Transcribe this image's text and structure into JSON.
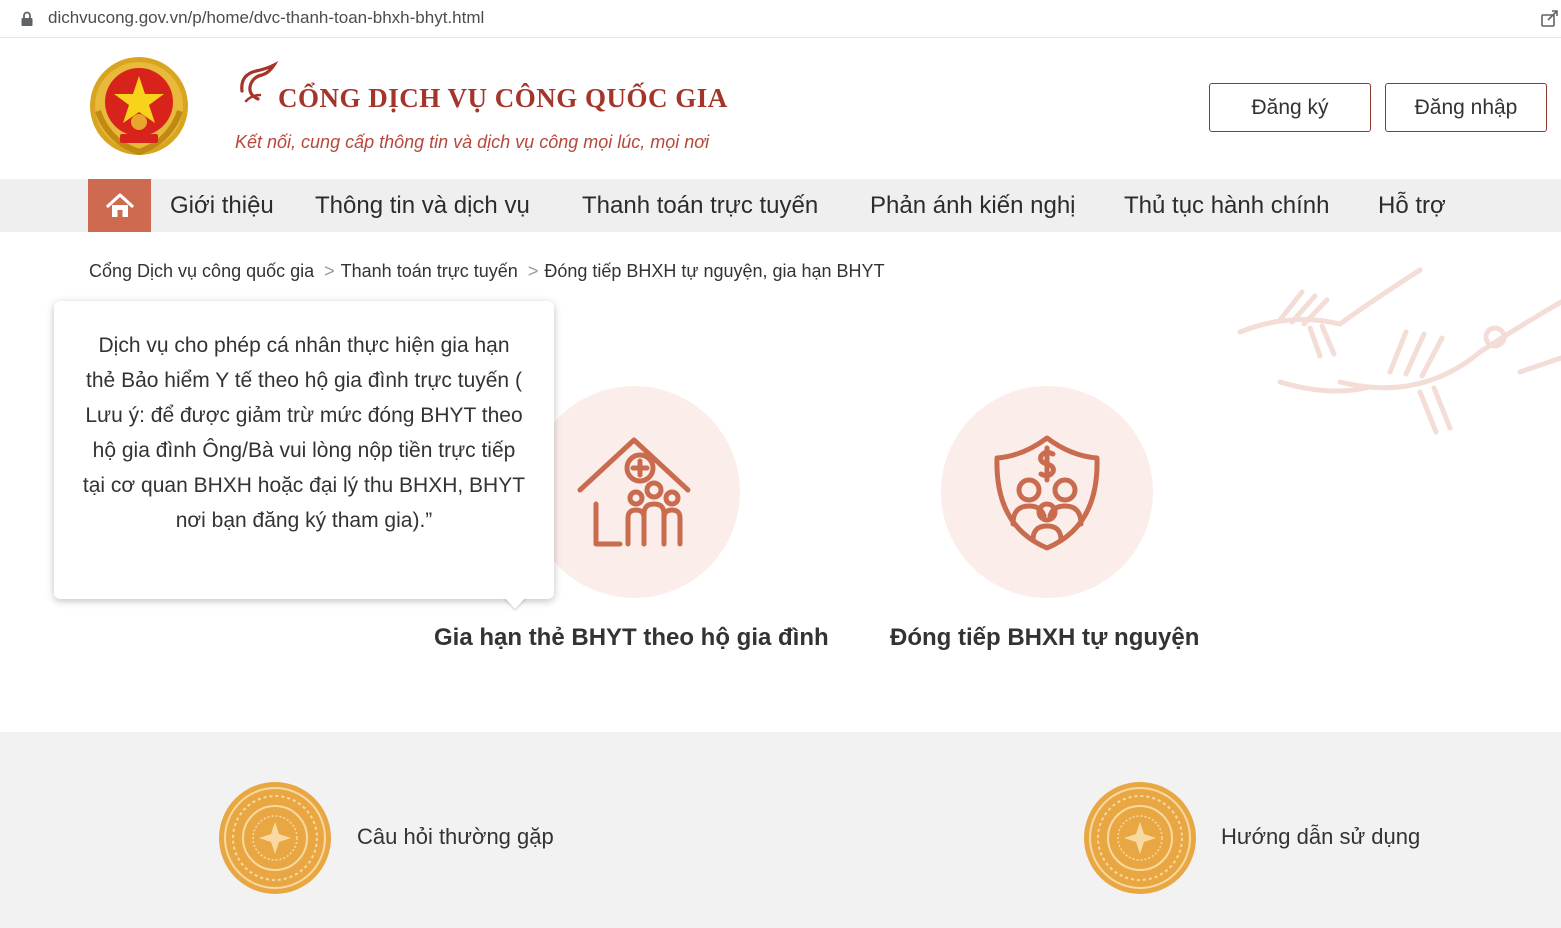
{
  "browser": {
    "url": "dichvucong.gov.vn/p/home/dvc-thanh-toan-bhxh-bhyt.html",
    "lock_icon": "lock-icon",
    "share_icon": "share-icon"
  },
  "header": {
    "title": "CỔNG DỊCH VỤ CÔNG QUỐC GIA",
    "tagline": "Kết nối, cung cấp thông tin và dịch vụ công mọi lúc, mọi nơi",
    "register_label": "Đăng ký",
    "login_label": "Đăng nhập"
  },
  "nav": {
    "home_icon": "home-icon",
    "items": [
      {
        "label": "Giới thiệu"
      },
      {
        "label": "Thông tin và dịch vụ"
      },
      {
        "label": "Thanh toán trực tuyến"
      },
      {
        "label": "Phản ánh kiến nghị"
      },
      {
        "label": "Thủ tục hành chính"
      },
      {
        "label": "Hỗ trợ"
      }
    ]
  },
  "breadcrumb": {
    "separator": ">",
    "items": [
      {
        "label": "Cổng Dịch vụ công quốc gia"
      },
      {
        "label": "Thanh toán trực tuyến"
      },
      {
        "label": "Đóng tiếp BHXH tự nguyện, gia hạn BHYT"
      }
    ]
  },
  "tooltip": {
    "text": "Dịch vụ cho phép cá nhân thực hiện gia hạn thẻ Bảo hiểm Y tế theo hộ gia đình trực tuyến ( Lưu ý: để được giảm trừ mức đóng BHYT theo hộ gia đình Ông/Bà vui lòng nộp tiền trực tiếp tại cơ quan BHXH hoặc đại lý thu BHXH, BHYT nơi bạn đăng ký tham gia).”"
  },
  "services": [
    {
      "label": "Gia hạn thẻ BHYT theo hộ gia đình",
      "icon": "family-house-icon"
    },
    {
      "label": "Đóng tiếp BHXH tự nguyện",
      "icon": "family-shield-icon"
    }
  ],
  "footer": {
    "links": [
      {
        "label": "Câu hỏi thường gặp",
        "icon": "bronze-drum-icon"
      },
      {
        "label": "Hướng dẫn sử dụng",
        "icon": "bronze-drum-icon"
      }
    ]
  },
  "colors": {
    "brand": "#a5352a",
    "accent": "#cd6a4f",
    "icon": "#c96b4e",
    "circle_bg": "#fbeeea",
    "nav_bg": "#efefef",
    "footer_bg": "#f2f2f2"
  }
}
